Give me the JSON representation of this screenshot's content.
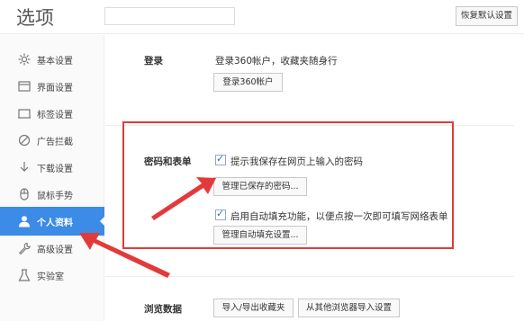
{
  "header": {
    "title": "选项",
    "search": {
      "value": "",
      "placeholder": ""
    },
    "restore_label": "恢复默认设置"
  },
  "sidebar": {
    "items": [
      {
        "label": "基本设置",
        "icon": "gear-icon",
        "active": false
      },
      {
        "label": "界面设置",
        "icon": "window-icon",
        "active": false
      },
      {
        "label": "标签设置",
        "icon": "tab-icon",
        "active": false
      },
      {
        "label": "广告拦截",
        "icon": "block-icon",
        "active": false
      },
      {
        "label": "下载设置",
        "icon": "download-icon",
        "active": false
      },
      {
        "label": "鼠标手势",
        "icon": "mouse-icon",
        "active": false
      },
      {
        "label": "个人资料",
        "icon": "person-icon",
        "active": true
      },
      {
        "label": "高级设置",
        "icon": "wrench-icon",
        "active": false
      },
      {
        "label": "实验室",
        "icon": "flask-icon",
        "active": false
      }
    ]
  },
  "login": {
    "label": "登录",
    "description": "登录360帐户，收藏夹随身行",
    "button": "登录360帐户"
  },
  "passwords": {
    "label": "密码和表单",
    "save_prompt": {
      "checked": true,
      "text": "提示我保存在网页上输入的密码"
    },
    "manage_passwords_button": "管理已保存的密码...",
    "autofill": {
      "checked": true,
      "text": "启用自动填充功能，以便点按一次即可填写网络表单"
    },
    "manage_autofill_button": "管理自动填充设置..."
  },
  "browsing_data": {
    "label": "浏览数据",
    "import_export_button": "导入/导出收藏夹",
    "import_other_button": "从其他浏览器导入设置"
  },
  "colors": {
    "accent": "#3c8be6",
    "annotation": "#e23a3a"
  }
}
